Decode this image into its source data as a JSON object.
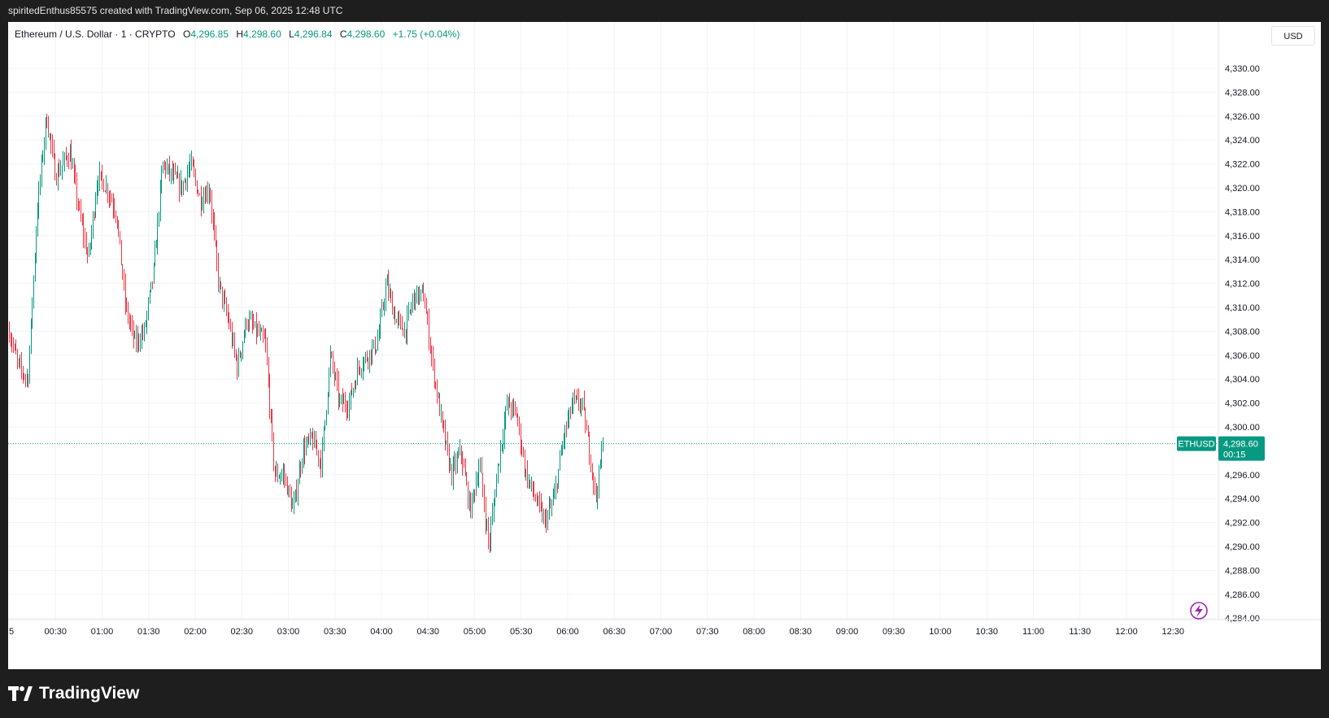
{
  "header": {
    "attribution": "spiritedEnthus85575 created with TradingView.com, Sep 06, 2025 12:48 UTC"
  },
  "legend": {
    "symbol": "Ethereum / U.S. Dollar · 1 · CRYPTO",
    "open_label": "O",
    "open": "4,296.85",
    "high_label": "H",
    "high": "4,298.60",
    "low_label": "L",
    "low": "4,296.84",
    "close_label": "C",
    "close": "4,298.60",
    "change": "+1.75 (+0.04%)"
  },
  "currency_button": "USD",
  "price_tag": {
    "symbol": "ETHUSD",
    "price": "4,298.60",
    "countdown": "00:15"
  },
  "footer": {
    "brand": "TradingView"
  },
  "colors": {
    "up": "#089981",
    "down": "#f23645",
    "grid": "#f0f3fa",
    "text": "#131722"
  },
  "icons": {
    "footer_logo": "tradingview-logo",
    "corner": "lightning-icon"
  },
  "chart_data": {
    "type": "candlestick",
    "x_tick_labels": [
      "5",
      "00:30",
      "01:00",
      "01:30",
      "02:00",
      "02:30",
      "03:00",
      "03:30",
      "04:00",
      "04:30",
      "05:00",
      "05:30",
      "06:00",
      "06:30",
      "07:00",
      "07:30",
      "08:00",
      "08:30",
      "09:00",
      "09:30",
      "10:00",
      "10:30",
      "11:00",
      "11:30",
      "12:00",
      "12:30"
    ],
    "y_tick_labels": [
      "4,330.00",
      "4,328.00",
      "4,326.00",
      "4,324.00",
      "4,322.00",
      "4,320.00",
      "4,318.00",
      "4,316.00",
      "4,314.00",
      "4,312.00",
      "4,310.00",
      "4,308.00",
      "4,306.00",
      "4,304.00",
      "4,302.00",
      "4,300.00",
      "4,296.00",
      "4,294.00",
      "4,292.00",
      "4,290.00",
      "4,288.00",
      "4,286.00",
      "4,284.00"
    ],
    "ylim": [
      4284,
      4334
    ],
    "last_price": 4298.6,
    "close_path": [
      [
        0.0,
        4308
      ],
      [
        0.2,
        4305
      ],
      [
        0.4,
        4304
      ],
      [
        0.6,
        4318
      ],
      [
        0.8,
        4326
      ],
      [
        1.0,
        4321
      ],
      [
        1.3,
        4323
      ],
      [
        1.5,
        4318
      ],
      [
        1.7,
        4314
      ],
      [
        1.9,
        4321
      ],
      [
        2.1,
        4320
      ],
      [
        2.3,
        4318
      ],
      [
        2.5,
        4310
      ],
      [
        2.7,
        4307
      ],
      [
        2.9,
        4308
      ],
      [
        3.1,
        4313
      ],
      [
        3.3,
        4322
      ],
      [
        3.5,
        4321
      ],
      [
        3.7,
        4320
      ],
      [
        3.9,
        4322
      ],
      [
        4.1,
        4319
      ],
      [
        4.3,
        4320
      ],
      [
        4.5,
        4312
      ],
      [
        4.7,
        4309
      ],
      [
        4.9,
        4305
      ],
      [
        5.1,
        4309
      ],
      [
        5.3,
        4308
      ],
      [
        5.5,
        4307
      ],
      [
        5.7,
        4296
      ],
      [
        5.9,
        4296
      ],
      [
        6.1,
        4293
      ],
      [
        6.3,
        4298
      ],
      [
        6.5,
        4299
      ],
      [
        6.7,
        4297
      ],
      [
        6.9,
        4306
      ],
      [
        7.1,
        4302
      ],
      [
        7.3,
        4302
      ],
      [
        7.5,
        4305
      ],
      [
        7.7,
        4306
      ],
      [
        7.9,
        4307
      ],
      [
        8.1,
        4312
      ],
      [
        8.3,
        4309
      ],
      [
        8.5,
        4308
      ],
      [
        8.7,
        4311
      ],
      [
        8.9,
        4311
      ],
      [
        9.1,
        4305
      ],
      [
        9.3,
        4300
      ],
      [
        9.5,
        4296
      ],
      [
        9.7,
        4298
      ],
      [
        9.9,
        4293
      ],
      [
        10.1,
        4297
      ],
      [
        10.3,
        4290
      ],
      [
        10.5,
        4297
      ],
      [
        10.7,
        4302
      ],
      [
        10.9,
        4301
      ],
      [
        11.1,
        4296
      ],
      [
        11.3,
        4294
      ],
      [
        11.5,
        4292
      ],
      [
        11.7,
        4294
      ],
      [
        11.9,
        4299
      ],
      [
        12.1,
        4302
      ],
      [
        12.3,
        4302
      ],
      [
        12.5,
        4297
      ],
      [
        12.6,
        4294
      ],
      [
        12.75,
        4298.6
      ]
    ]
  }
}
